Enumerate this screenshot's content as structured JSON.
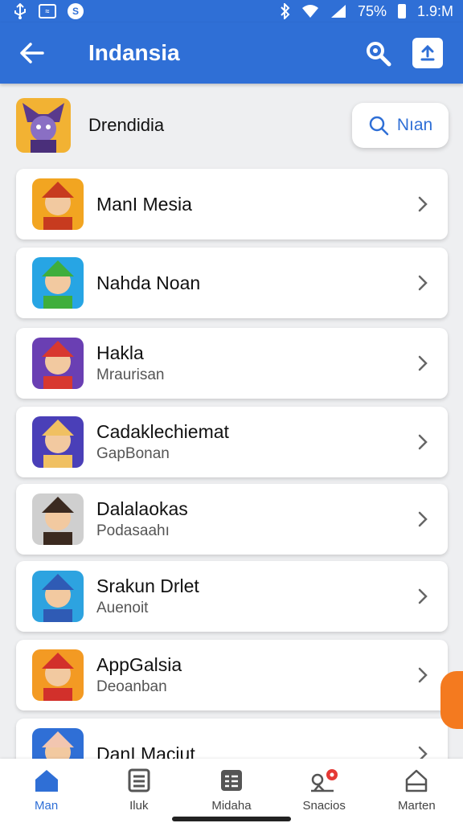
{
  "status_bar": {
    "battery": "75%",
    "time": "1.9:M",
    "left_icons": [
      "usb-icon",
      "notification-box-icon",
      "shazam-icon"
    ],
    "right_icons": [
      "bluetooth-icon",
      "wifi-icon",
      "signal-icon",
      "battery-icon"
    ]
  },
  "app_bar": {
    "title": "Indansia",
    "back_icon": "back-arrow-icon",
    "actions": [
      "search-settings-icon",
      "upload-icon"
    ]
  },
  "header": {
    "title": "Drendidia",
    "search_button_label": "Nıan",
    "search_icon": "search-icon"
  },
  "items": [
    {
      "title": "ManI Mesia",
      "subtitle": "",
      "thumb_colors": [
        "#f2a521",
        "#c73b1f"
      ]
    },
    {
      "title": "Nahda Noan",
      "subtitle": "",
      "thumb_colors": [
        "#27a5e4",
        "#3fae3c"
      ]
    },
    {
      "title": "Hakla",
      "subtitle": "Mraurisan",
      "thumb_colors": [
        "#6a3fb3",
        "#d8382f"
      ]
    },
    {
      "title": "Cadaklechiemat",
      "subtitle": "GapBonan",
      "thumb_colors": [
        "#4a3fb8",
        "#f0c062"
      ]
    },
    {
      "title": "Dalalaokas",
      "subtitle": "Podasaahı",
      "thumb_colors": [
        "#cfcfcf",
        "#3b2a20"
      ]
    },
    {
      "title": "Srakun Drlet",
      "subtitle": "Auenoit",
      "thumb_colors": [
        "#2da3e0",
        "#2f5bb5"
      ]
    },
    {
      "title": "AppGalsia",
      "subtitle": "Deoanban",
      "thumb_colors": [
        "#f39a23",
        "#d2302b"
      ]
    },
    {
      "title": "DanI Maciut",
      "subtitle": "",
      "thumb_colors": [
        "#2f6fd6",
        "#f2c6b0"
      ]
    }
  ],
  "bottom_nav": [
    {
      "label": "Man",
      "icon": "home-icon",
      "active": true
    },
    {
      "label": "Iluk",
      "icon": "list-icon",
      "active": false
    },
    {
      "label": "Midaha",
      "icon": "grid-list-icon",
      "active": false
    },
    {
      "label": "Snacios",
      "icon": "games-icon",
      "active": false
    },
    {
      "label": "Marten",
      "icon": "store-icon",
      "active": false
    }
  ],
  "colors": {
    "primary": "#2f6fd6",
    "background": "#eeeff1",
    "accent": "#f47a1f",
    "badge": "#e53935"
  }
}
